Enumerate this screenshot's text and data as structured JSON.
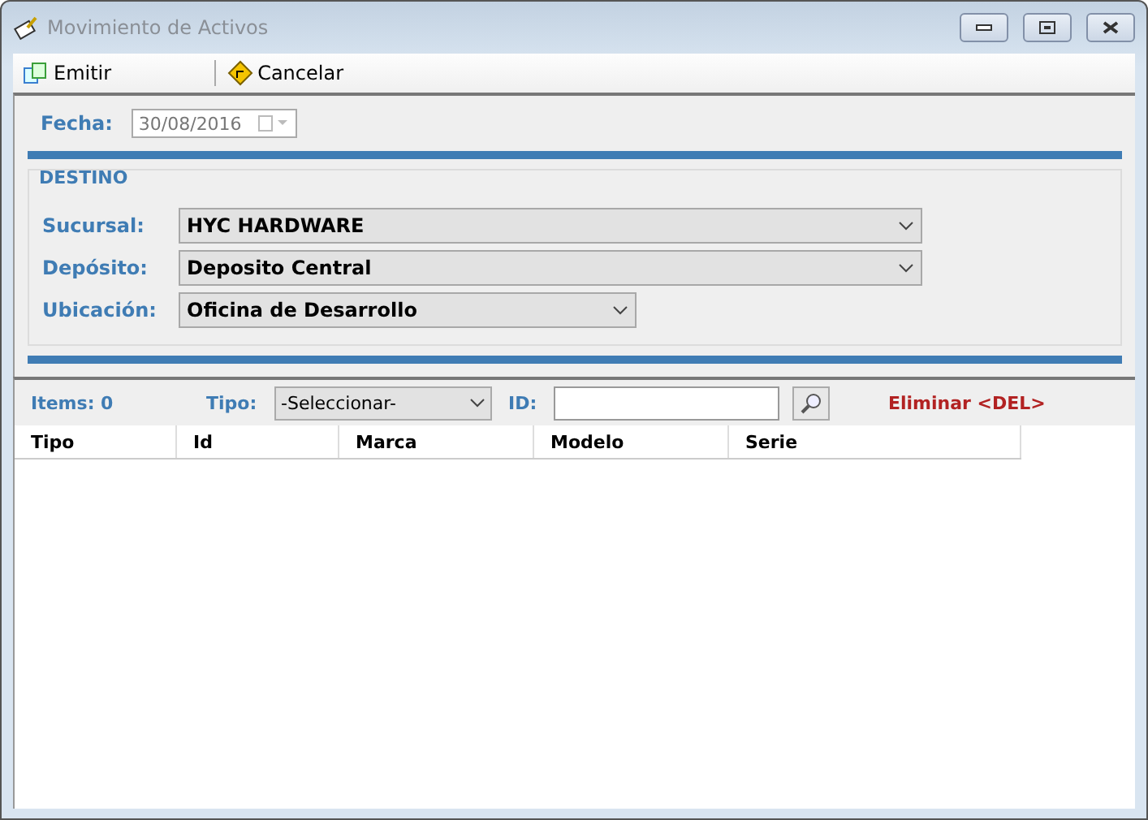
{
  "window": {
    "title": "Movimiento de Activos"
  },
  "toolbar": [
    {
      "label": "Emitir",
      "kind": "emit"
    },
    {
      "label": "Cancelar",
      "kind": "cancel"
    }
  ],
  "fecha": {
    "label": "Fecha:",
    "value": "30/08/2016",
    "disabled": true
  },
  "destino": {
    "title": "DESTINO",
    "fields": [
      {
        "label": "Sucursal:",
        "value": "HYC HARDWARE",
        "wide": true
      },
      {
        "label": "Depósito:",
        "value": "Deposito Central",
        "wide": true
      },
      {
        "label": "Ubicación:",
        "value": "Oficina de Desarrollo",
        "wide": false
      }
    ]
  },
  "items": {
    "count": "Items: 0",
    "tipo_label": "Tipo:",
    "tipo_value": "-Seleccionar-",
    "id_label": "ID:",
    "delete": "Eliminar <DEL>"
  },
  "table": {
    "columns": [
      "Tipo",
      "Id",
      "Marca",
      "Modelo",
      "Serie"
    ]
  }
}
